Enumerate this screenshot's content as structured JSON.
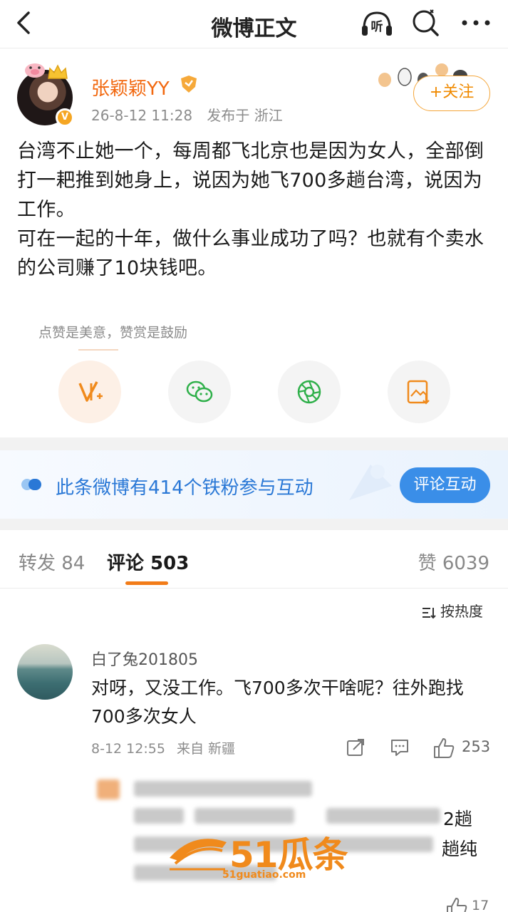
{
  "nav": {
    "title": "微博正文",
    "listen_label": "听"
  },
  "post": {
    "username": "张颖颖YY",
    "time": "26-8-12 11:28",
    "location": "发布于 浙江",
    "follow_label": "+关注",
    "text_lines": [
      "台湾不止她一个，每周都飞北京也是因为女人，全部倒打一耙推到她身上，说因为她飞700多趟台湾，说因为工作。",
      "可在一起的十年，做什么事业成功了吗？也就有个卖水的公司赚了10块钱吧。"
    ]
  },
  "reward": {
    "tip": "点赞是美意，赞赏是鼓励"
  },
  "banner": {
    "text": "此条微博有414个铁粉参与互动",
    "button": "评论互动"
  },
  "tabs": {
    "repost": "转发 84",
    "comment": "评论 503",
    "like": "赞 6039"
  },
  "sort": {
    "label": "按热度"
  },
  "comment": {
    "name": "白了兔201805",
    "text": "对呀，又没工作。飞700多次干啥呢？往外跑找700多次女人",
    "time": "8-12 12:55",
    "location": "来自 新疆",
    "likes": "253"
  },
  "reply_partial": {
    "line1": "2趟",
    "line2": "趟纯"
  },
  "watermark": {
    "text": "51瓜条",
    "url": "51guatiao.com"
  },
  "bottom": {
    "likes": "17"
  },
  "colors": {
    "accent": "#f2680f",
    "link_blue": "#2a78d6",
    "button_blue": "#3a8ee8",
    "tab_underline": "#f27c18"
  }
}
